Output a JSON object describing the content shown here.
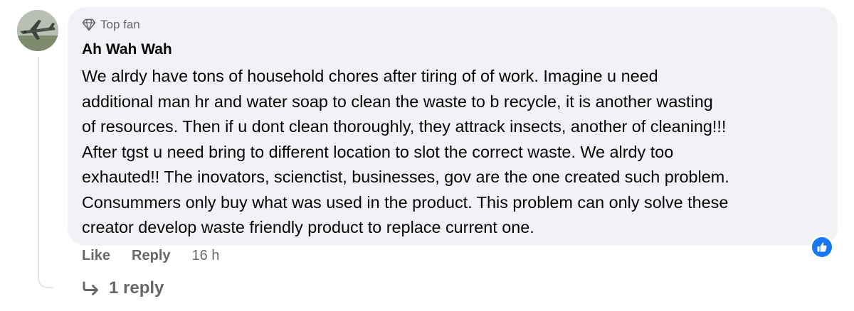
{
  "comment": {
    "badge_label": "Top fan",
    "badge_icon": "diamond-icon",
    "author": "Ah Wah Wah",
    "text_lines": [
      "We alrdy have tons of household chores after tiring of of work. Imagine u need",
      "additional man hr and water soap to clean the waste to b recycle, it is another wasting",
      "of resources. Then if u dont clean thoroughly, they attrack insects, another of cleaning!!!",
      "After tgst u need bring to different location to slot the correct waste. We alrdy too",
      "exhauted!! The inovators, scienctist, businesses, gov are the one created such problem.",
      "Consummers only buy what was used in the product. This problem can only solve these",
      "creator develop waste friendly product to replace current one."
    ],
    "reaction_icon": "thumbs-up-icon",
    "reaction_color": "#1877f2"
  },
  "actions": {
    "like_label": "Like",
    "reply_label": "Reply",
    "timestamp": "16 h"
  },
  "replies": {
    "label": "1 reply",
    "icon": "reply-arrow-icon"
  },
  "colors": {
    "bubble_bg": "#f0f2f5",
    "secondary_text": "#65676b",
    "primary_text": "#050505"
  }
}
